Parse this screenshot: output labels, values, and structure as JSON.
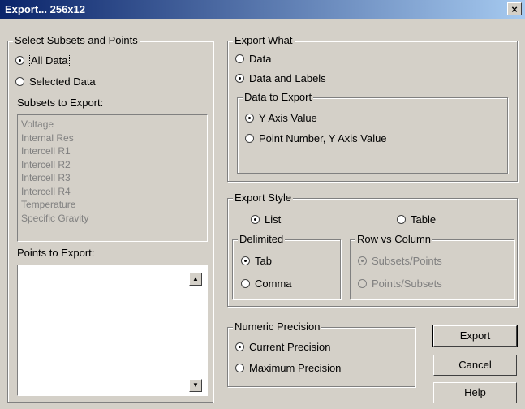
{
  "window": {
    "title": "Export... 256x12",
    "close_label": "×"
  },
  "subsets_group": {
    "legend": "Select Subsets and Points",
    "all_data": "All Data",
    "selected_data": "Selected Data",
    "subsets_label": "Subsets to Export:",
    "subsets": [
      "Voltage",
      "Internal Res",
      "Intercell R1",
      "Intercell R2",
      "Intercell R3",
      "Intercell R4",
      "Temperature",
      "Specific Gravity"
    ],
    "points_label": "Points to Export:"
  },
  "export_what": {
    "legend": "Export What",
    "data": "Data",
    "data_and_labels": "Data and Labels",
    "data_to_export": {
      "legend": "Data to Export",
      "y_axis_value": "Y Axis Value",
      "point_number_y": "Point Number, Y Axis Value"
    }
  },
  "export_style": {
    "legend": "Export Style",
    "list": "List",
    "table": "Table",
    "delimited": {
      "legend": "Delimited",
      "tab": "Tab",
      "comma": "Comma"
    },
    "row_vs_column": {
      "legend": "Row vs Column",
      "subsets_points": "Subsets/Points",
      "points_subsets": "Points/Subsets"
    }
  },
  "numeric_precision": {
    "legend": "Numeric Precision",
    "current": "Current Precision",
    "maximum": "Maximum Precision"
  },
  "buttons": {
    "export": "Export",
    "cancel": "Cancel",
    "help": "Help"
  }
}
